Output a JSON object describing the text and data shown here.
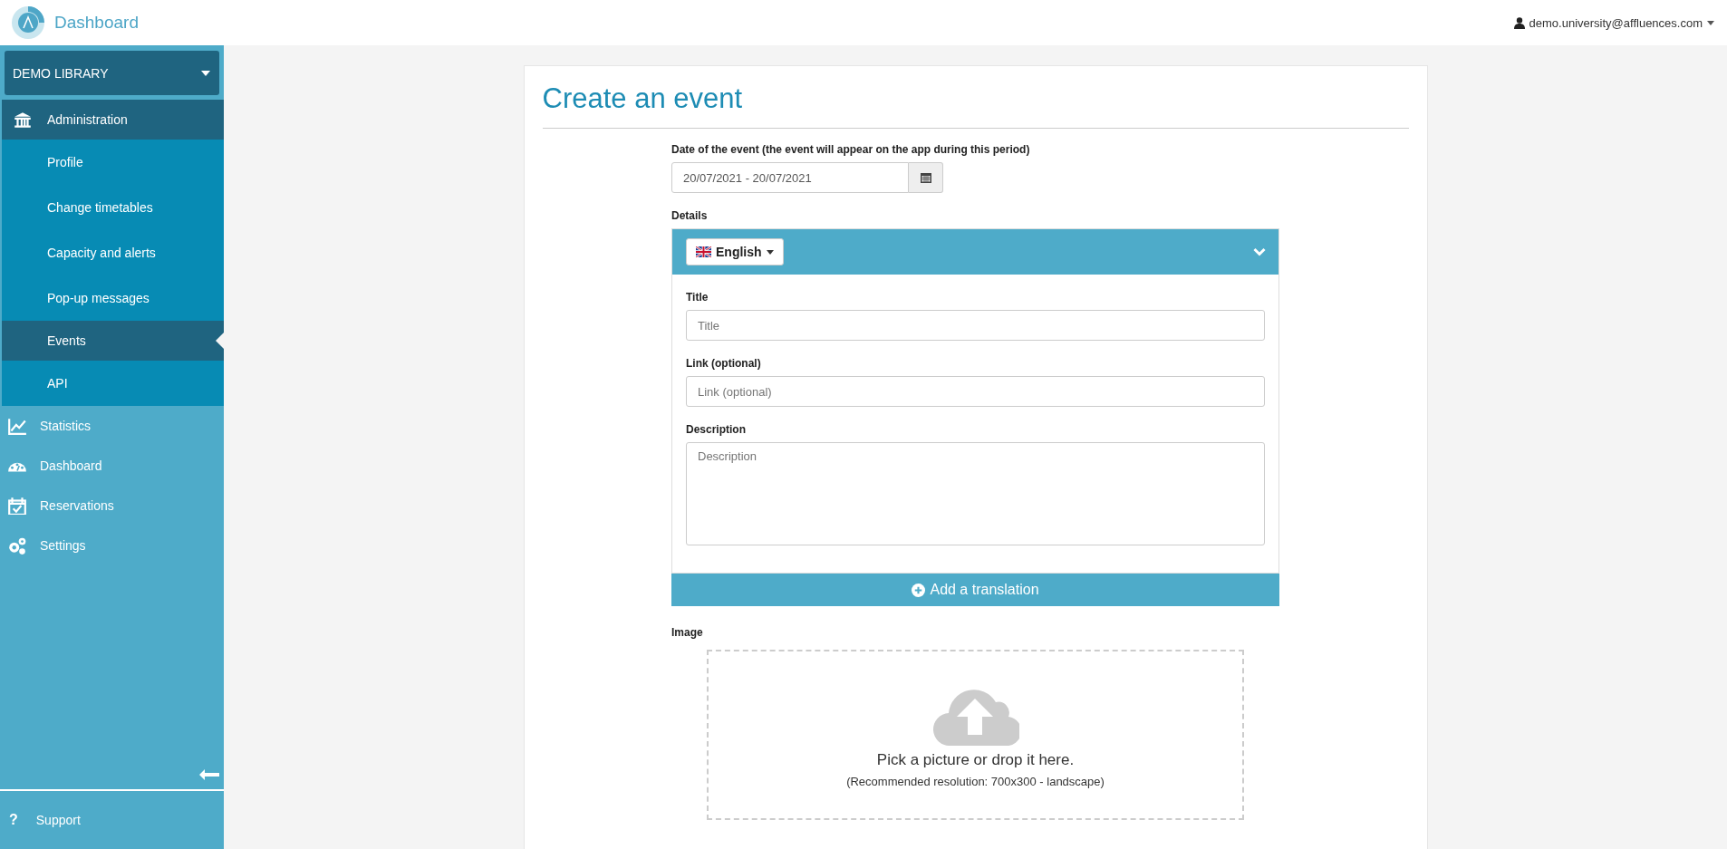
{
  "header": {
    "app_title": "Dashboard",
    "user": "demo.university@affluences.com"
  },
  "sidebar": {
    "library": "DEMO LIBRARY",
    "items": [
      {
        "label": "Administration",
        "expanded": true,
        "children": [
          {
            "label": "Profile",
            "selected": false
          },
          {
            "label": "Change timetables",
            "selected": false
          },
          {
            "label": "Capacity and alerts",
            "selected": false
          },
          {
            "label": "Pop-up messages",
            "selected": false
          },
          {
            "label": "Events",
            "selected": true
          },
          {
            "label": "API",
            "selected": false
          }
        ]
      },
      {
        "label": "Statistics",
        "expanded": false
      },
      {
        "label": "Dashboard",
        "expanded": false
      },
      {
        "label": "Reservations",
        "expanded": false
      },
      {
        "label": "Settings",
        "expanded": false
      }
    ],
    "support_icon": "?",
    "support": "Support"
  },
  "form": {
    "title": "Create an event",
    "date_label": "Date of the event (the event will appear on the app during this period)",
    "date_value": "20/07/2021 - 20/07/2021",
    "details_label": "Details",
    "language": "English",
    "fields": [
      {
        "kind": "input",
        "label": "Title",
        "placeholder": "Title"
      },
      {
        "kind": "input",
        "label": "Link (optional)",
        "placeholder": "Link (optional)"
      },
      {
        "kind": "textarea",
        "label": "Description",
        "placeholder": "Description"
      }
    ],
    "add_translation": "Add a translation",
    "image_label": "Image",
    "drop_text": "Pick a picture or drop it here.",
    "drop_hint": "(Recommended resolution: 700x300 - landscape)"
  }
}
